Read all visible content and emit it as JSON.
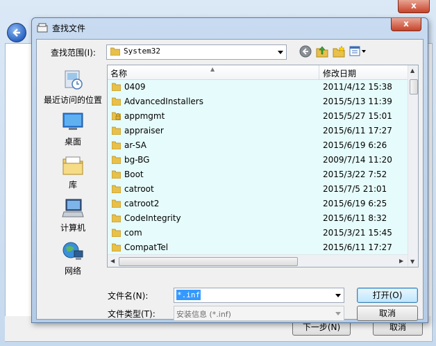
{
  "background_window": {
    "close_label": "x",
    "next_label": "下一步(N)",
    "cancel_label": "取消"
  },
  "dialog": {
    "title": "查找文件",
    "close_label": "x",
    "look_in": {
      "label": "查找范围(I):",
      "value": "System32"
    },
    "places": [
      {
        "label": "最近访问的位置",
        "icon": "recent-places-icon"
      },
      {
        "label": "桌面",
        "icon": "desktop-icon"
      },
      {
        "label": "库",
        "icon": "libraries-icon"
      },
      {
        "label": "计算机",
        "icon": "computer-icon"
      },
      {
        "label": "网络",
        "icon": "network-icon"
      }
    ],
    "columns": {
      "name": "名称",
      "date": "修改日期"
    },
    "files": [
      {
        "name": "0409",
        "date": "2011/4/12 15:38",
        "locked": false
      },
      {
        "name": "AdvancedInstallers",
        "date": "2015/5/13 11:39",
        "locked": false
      },
      {
        "name": "appmgmt",
        "date": "2015/5/27 15:01",
        "locked": true
      },
      {
        "name": "appraiser",
        "date": "2015/6/11 17:27",
        "locked": false
      },
      {
        "name": "ar-SA",
        "date": "2015/6/19 6:26",
        "locked": false
      },
      {
        "name": "bg-BG",
        "date": "2009/7/14 11:20",
        "locked": false
      },
      {
        "name": "Boot",
        "date": "2015/3/22 7:52",
        "locked": false
      },
      {
        "name": "catroot",
        "date": "2015/7/5 21:01",
        "locked": false
      },
      {
        "name": "catroot2",
        "date": "2015/6/19 6:25",
        "locked": false
      },
      {
        "name": "CodeIntegrity",
        "date": "2015/6/11 8:32",
        "locked": false
      },
      {
        "name": "com",
        "date": "2015/3/21 15:45",
        "locked": false
      },
      {
        "name": "CompatTel",
        "date": "2015/6/11 17:27",
        "locked": false
      }
    ],
    "filename": {
      "label": "文件名(N):",
      "value": "*.inf"
    },
    "filetype": {
      "label": "文件类型(T):",
      "value": "安装信息 (*.inf)"
    },
    "open_label": "打开(O)",
    "cancel_label": "取消"
  }
}
